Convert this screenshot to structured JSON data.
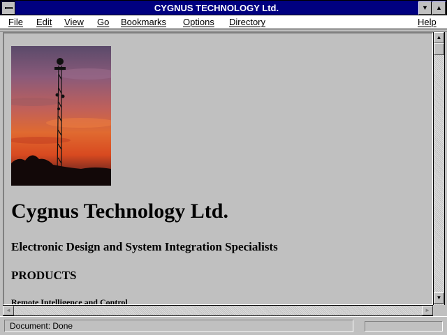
{
  "window": {
    "title": "CYGNUS TECHNOLOGY Ltd.",
    "minimize_glyph": "▼",
    "maximize_glyph": "▲",
    "icons": [
      "system-menu-icon",
      "minimize-icon",
      "maximize-icon"
    ]
  },
  "menu": {
    "file": "File",
    "edit": "Edit",
    "view": "View",
    "go": "Go",
    "bookmarks": "Bookmarks",
    "options": "Options",
    "directory": "Directory",
    "help": "Help"
  },
  "page": {
    "image_alt": "communications tower at sunset",
    "heading": "Cygnus Technology Ltd.",
    "tagline": "Electronic Design and System Integration Specialists",
    "products_heading": "PRODUCTS",
    "sub_heading": "Remote Intelligence and Control"
  },
  "scrollbars": {
    "up_glyph": "▲",
    "down_glyph": "▼",
    "left_glyph": "◄",
    "right_glyph": "►",
    "vertical_position": 0
  },
  "status": {
    "text": "Document: Done",
    "progress": 0
  },
  "colors": {
    "titlebar": "#000080",
    "chrome": "#c0c0c0",
    "menubar": "#ffffff"
  }
}
